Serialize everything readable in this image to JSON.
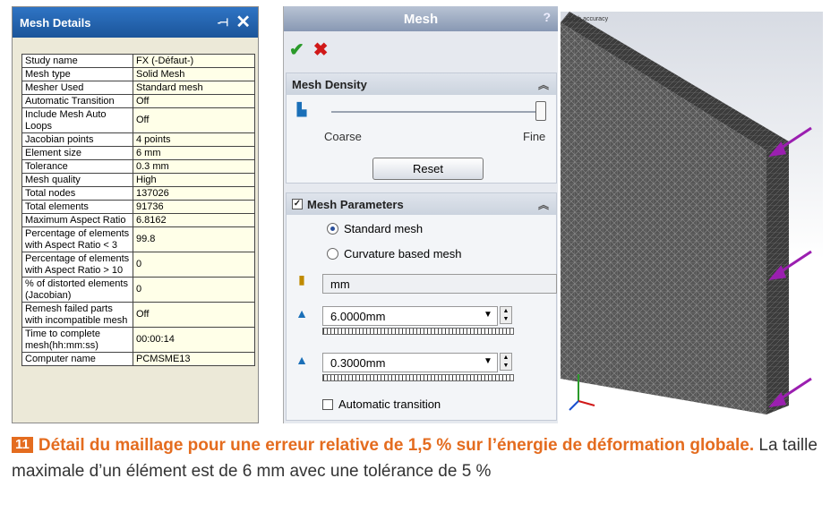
{
  "details": {
    "title": "Mesh Details",
    "rows": [
      {
        "k": "Study name",
        "v": "FX (-Défaut-)"
      },
      {
        "k": "Mesh type",
        "v": "Solid Mesh"
      },
      {
        "k": "Mesher Used",
        "v": "Standard mesh"
      },
      {
        "k": "Automatic Transition",
        "v": "Off"
      },
      {
        "k": "Include Mesh Auto Loops",
        "v": "Off"
      },
      {
        "k": "Jacobian points",
        "v": "4 points"
      },
      {
        "k": "Element size",
        "v": "6 mm"
      },
      {
        "k": "Tolerance",
        "v": "0.3 mm"
      },
      {
        "k": "Mesh quality",
        "v": "High"
      },
      {
        "k": "Total nodes",
        "v": "137026"
      },
      {
        "k": "Total elements",
        "v": "91736"
      },
      {
        "k": "Maximum Aspect Ratio",
        "v": "6.8162"
      },
      {
        "k": "Percentage of elements with Aspect Ratio < 3",
        "v": "99.8"
      },
      {
        "k": "Percentage of elements with Aspect Ratio > 10",
        "v": "0"
      },
      {
        "k": "% of distorted elements (Jacobian)",
        "v": "0"
      },
      {
        "k": "Remesh failed parts with incompatible mesh",
        "v": "Off"
      },
      {
        "k": "Time to complete mesh(hh:mm:ss)",
        "v": "00:00:14"
      },
      {
        "k": "Computer name",
        "v": "PCMSME13"
      }
    ]
  },
  "mesh": {
    "title": "Mesh",
    "help": "?",
    "density": {
      "title": "Mesh Density",
      "coarse": "Coarse",
      "fine": "Fine",
      "reset": "Reset",
      "slider_level": 1.0
    },
    "params": {
      "title": "Mesh Parameters",
      "radio_standard": "Standard mesh",
      "radio_curvature": "Curvature based mesh",
      "unit": "mm",
      "element_size": "6.0000mm",
      "tolerance": "0.3000mm",
      "auto_transition": "Automatic transition"
    }
  },
  "viewport": {
    "overlay": [
      "Mesh accuracy",
      "",
      ""
    ]
  },
  "caption": {
    "number": "11",
    "bold": "Détail du maillage pour une erreur relative de 1,5 % sur l’énergie de déformation globale.",
    "normal": " La taille maximale d’un élément est de 6 mm avec une tolérance de 5 %"
  },
  "colors": {
    "accent": "#e46c1f",
    "titlebar": "#1f5fa8",
    "mesh_face": "#4a4a4a",
    "arrow": "#9b1fb0"
  }
}
